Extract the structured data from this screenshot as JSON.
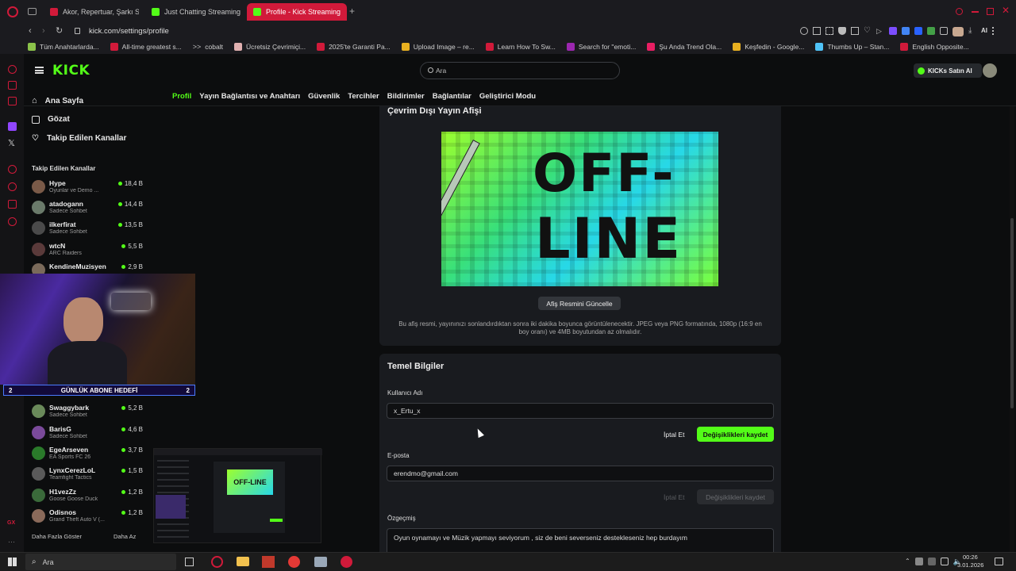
{
  "browser": {
    "tabs": [
      {
        "label": "Akor, Repertuar, Şarkı Söz",
        "favicon_color": "#d11a3a"
      },
      {
        "label": "Just Chatting Streaming -",
        "favicon_color": "#53fc18"
      },
      {
        "label": "Profile - Kick Streaming",
        "favicon_color": "#53fc18",
        "active": true
      }
    ],
    "new_tab": "+",
    "url": "kick.com/settings/profile",
    "bookmarks": [
      {
        "label": "Tüm Anahtarlarda...",
        "color": "#8bc34a"
      },
      {
        "label": "All-time greatest s...",
        "color": "#d11a3a"
      },
      {
        "label": "cobalt",
        "color": "#bbbbbb"
      },
      {
        "label": "Ücretsiz Çevrimiçi...",
        "color": "#e0b0b0"
      },
      {
        "label": "2025'te Garanti Pa...",
        "color": "#d11a3a"
      },
      {
        "label": "Upload Image – re...",
        "color": "#e8b020"
      },
      {
        "label": "Learn How To Sw...",
        "color": "#d11a3a"
      },
      {
        "label": "Search for \"emoti...",
        "color": "#9c27b0"
      },
      {
        "label": "Şu Anda Trend Ola...",
        "color": "#e91e63"
      },
      {
        "label": "Keşfedin - Google...",
        "color": "#e8b020"
      },
      {
        "label": "Thumbs Up – Stan...",
        "color": "#4fc3f7"
      },
      {
        "label": "English Opposite...",
        "color": "#d11a3a"
      }
    ]
  },
  "kick": {
    "logo": "KICK",
    "search_placeholder": "Ara",
    "buy_kicks": "KICKs Satın Al",
    "nav": [
      {
        "label": "Ana Sayfa",
        "icon": "home-icon"
      },
      {
        "label": "Gözat",
        "icon": "browse-icon"
      },
      {
        "label": "Takip Edilen Kanallar",
        "icon": "heart-icon"
      }
    ],
    "followed_title": "Takip Edilen Kanallar",
    "channels_top": [
      {
        "name": "Hype",
        "category": "Oyunlar ve Demo ...",
        "viewers": "18,4 B",
        "color": "#7a5a48"
      },
      {
        "name": "atadogann",
        "category": "Sadece Sohbet",
        "viewers": "14,4 B",
        "color": "#6a7a6a"
      },
      {
        "name": "ilkerfirat",
        "category": "Sadece Sohbet",
        "viewers": "13,5 B",
        "color": "#4a4a4a"
      },
      {
        "name": "wtcN",
        "category": "ARC Raiders",
        "viewers": "5,5 B",
        "color": "#5a3a3a"
      },
      {
        "name": "KendineMuzisyen",
        "category": "",
        "viewers": "2,9 B",
        "color": "#7a6a5a"
      }
    ],
    "channels_bottom": [
      {
        "name": "Swaggybark",
        "category": "Sadece Sohbet",
        "viewers": "5,2 B",
        "color": "#6a8a5a"
      },
      {
        "name": "BarisG",
        "category": "Sadece Sohbet",
        "viewers": "4,6 B",
        "color": "#7a4a9a"
      },
      {
        "name": "EgeArseven",
        "category": "EA Sports FC 26",
        "viewers": "3,7 B",
        "color": "#2a7a2a"
      },
      {
        "name": "LynxCerezLoL",
        "category": "Teamfight Tactics",
        "viewers": "1,5 B",
        "color": "#5a5a5a"
      },
      {
        "name": "H1vezZz",
        "category": "Goose Goose Duck",
        "viewers": "1,2 B",
        "color": "#3a6a3a"
      },
      {
        "name": "Odisnos",
        "category": "Grand Theft Auto V (...",
        "viewers": "1,2 B",
        "color": "#8a6a5a"
      }
    ],
    "show_more": "Daha Fazla Göster",
    "show_less": "Daha Az",
    "settings_tabs": [
      "Profil",
      "Yayın Bağlantısı ve Anahtarı",
      "Güvenlik",
      "Tercihler",
      "Bildirimler",
      "Bağlantılar",
      "Geliştirici Modu"
    ],
    "offline_banner": {
      "title": "Çevrim Dışı Yayın Afişi",
      "image_text_line1": "OFF-",
      "image_text_line2": "LINE",
      "button": "Afiş Resmini Güncelle",
      "description": "Bu afiş resmi, yayınınızı sonlandırdıktan sonra iki dakika boyunca görüntülenecektir. JPEG veya PNG formatında, 1080p (16:9 en boy oranı) ve 4MB boyutundan az olmalıdır."
    },
    "basic_info": {
      "title": "Temel Bilgiler",
      "username_label": "Kullanıcı Adı",
      "username_value": "x_Ertu_x",
      "cancel": "İptal Et",
      "save": "Değişiklikleri kaydet",
      "email_label": "E-posta",
      "email_value": "erendmo@gmail.com",
      "bio_label": "Özgeçmiş",
      "bio_value": "Oyun oynamayı ve Müzik yapmayı seviyorum , siz de beni severseniz destekleseniz hep burdayım"
    }
  },
  "overlay": {
    "goal_left": "2",
    "goal_text": "GÜNLÜK ABONE HEDEFİ",
    "goal_right": "2",
    "mini_offline_text": "OFF-LINE"
  },
  "taskbar": {
    "search_placeholder": "Ara",
    "time": "00:26",
    "date": "3.01.2026"
  }
}
